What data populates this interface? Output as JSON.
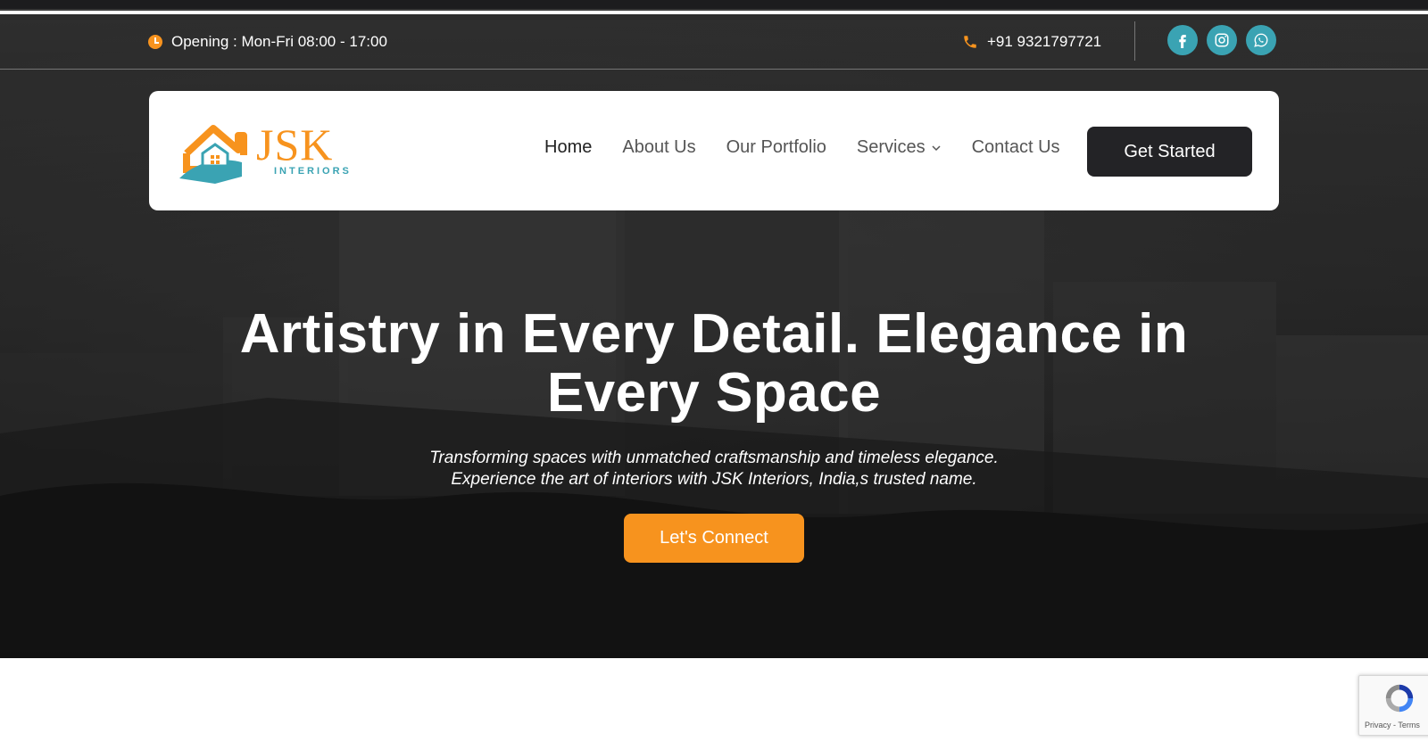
{
  "topbar": {
    "opening_text": "Opening : Mon-Fri 08:00 - 17:00",
    "phone_text": "+91 9321797721",
    "socials": [
      "facebook-icon",
      "instagram-icon",
      "whatsapp-icon"
    ]
  },
  "logo": {
    "name": "JSK",
    "subtitle": "INTERIORS"
  },
  "nav": {
    "items": [
      {
        "label": "Home"
      },
      {
        "label": "About Us"
      },
      {
        "label": "Our Portfolio"
      },
      {
        "label": "Services"
      },
      {
        "label": "Contact Us"
      }
    ],
    "cta_label": "Get Started"
  },
  "hero": {
    "headline_line1": "Artistry in Every Detail. Elegance in",
    "headline_line2": "Every Space",
    "subtext_line1": "Transforming spaces with unmatched craftsmanship and timeless elegance.",
    "subtext_line2": "Experience the art of interiors with JSK Interiors, India,s trusted name.",
    "button_label": "Let's Connect"
  },
  "recaptcha": {
    "privacy": "Privacy",
    "separator": " - ",
    "terms": "Terms"
  },
  "colors": {
    "accent_orange": "#f7931e",
    "accent_teal": "#3aa3b3",
    "dark_button": "#232326"
  }
}
